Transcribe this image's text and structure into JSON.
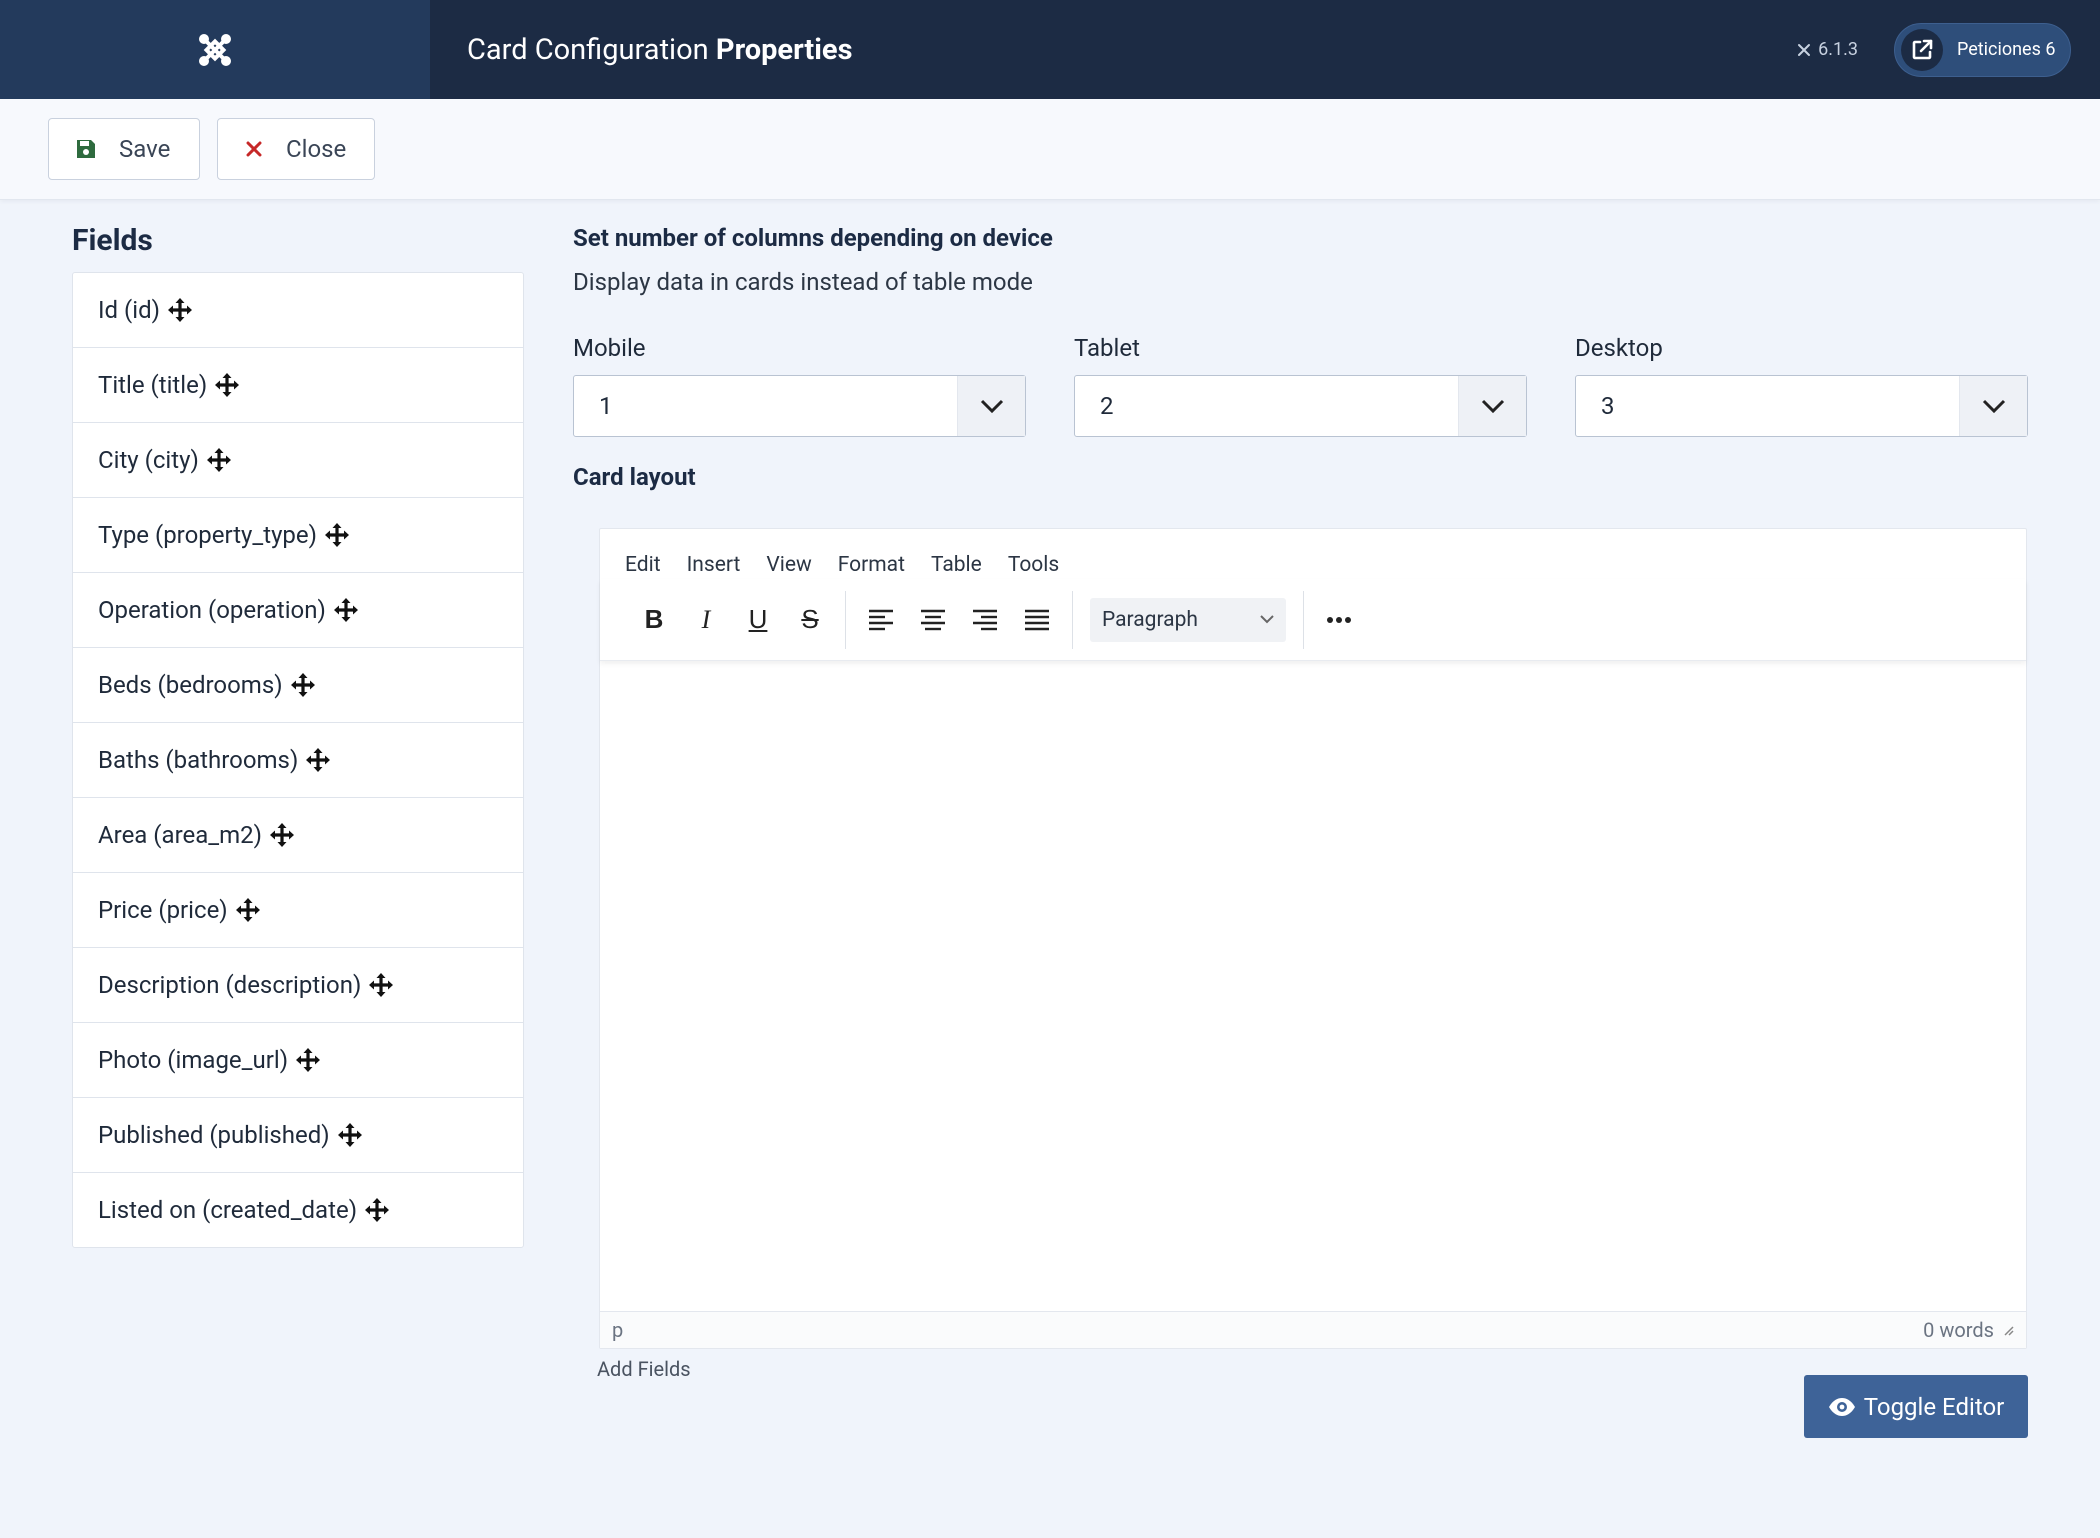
{
  "header": {
    "title_prefix": "Card Configuration",
    "title_strong": "Properties",
    "version": "6.1.3",
    "requests_label": "Peticiones 6"
  },
  "toolbar": {
    "save_label": "Save",
    "close_label": "Close"
  },
  "fields": {
    "title": "Fields",
    "items": [
      "Id (id)",
      "Title (title)",
      "City (city)",
      "Type (property_type)",
      "Operation (operation)",
      "Beds (bedrooms)",
      "Baths (bathrooms)",
      "Area (area_m2)",
      "Price (price)",
      "Description (description)",
      "Photo (image_url)",
      "Published (published)",
      "Listed on (created_date)"
    ]
  },
  "columns": {
    "heading": "Set number of columns depending on device",
    "description": "Display data in cards instead of table mode",
    "mobile_label": "Mobile",
    "mobile_value": "1",
    "tablet_label": "Tablet",
    "tablet_value": "2",
    "desktop_label": "Desktop",
    "desktop_value": "3"
  },
  "card_layout": {
    "heading": "Card layout",
    "menu": [
      "Edit",
      "Insert",
      "View",
      "Format",
      "Table",
      "Tools"
    ],
    "block_format": "Paragraph",
    "status_path": "p",
    "word_count": "0 words",
    "add_fields_label": "Add Fields",
    "toggle_editor_label": "Toggle Editor"
  },
  "colors": {
    "header_bg": "#1c2b44",
    "logo_bg": "#233a5c",
    "accent": "#3e6398",
    "page_bg": "#f0f4fb"
  }
}
